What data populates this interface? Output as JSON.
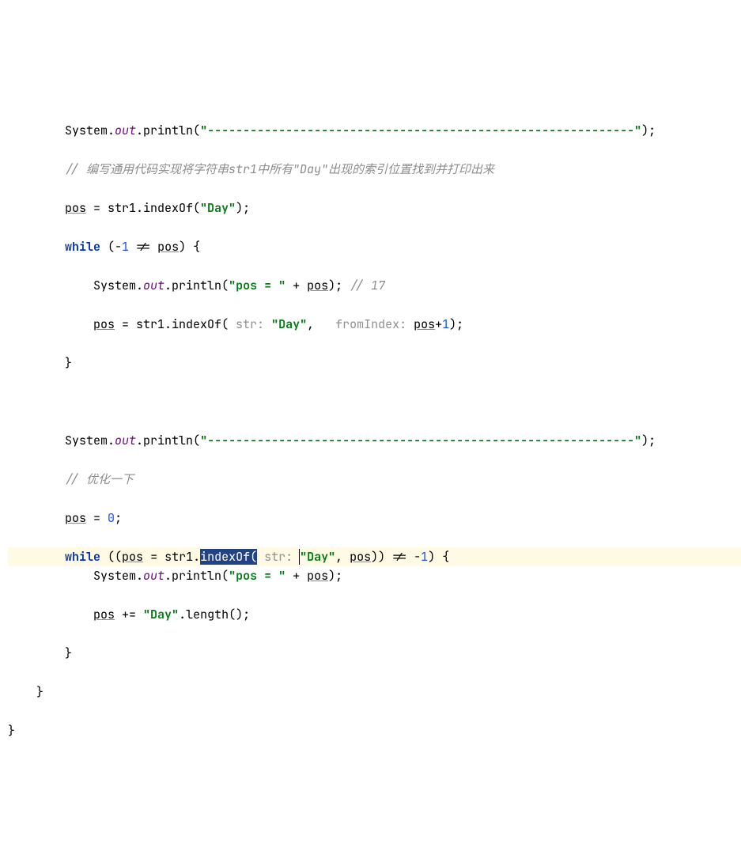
{
  "code": {
    "indent2": "        ",
    "indent3": "            ",
    "indent1": "    ",
    "indent0": "",
    "l1_a": "System.",
    "l1_out": "out",
    "l1_b": ".println(",
    "l1_str": "\"------------------------------------------------------------\"",
    "l1_c": ");",
    "l2_cmt": "// 编写通用代码实现将字符串str1中所有\"Day\"出现的索引位置找到并打印出来",
    "l3_pos": "pos",
    "l3_a": " = str1.indexOf(",
    "l3_str": "\"Day\"",
    "l3_b": ");",
    "l4_while": "while",
    "l4_a": " (-",
    "l4_num1": "1",
    "l4_b": " != ",
    "l4_pos": "pos",
    "l4_c": ") {",
    "l5_a": "System.",
    "l5_out": "out",
    "l5_b": ".println(",
    "l5_str": "\"pos = \"",
    "l5_c": " + ",
    "l5_pos": "pos",
    "l5_d": "); ",
    "l5_cmt": "// 17",
    "l6_pos": "pos",
    "l6_a": " = str1.indexOf(",
    "l6_hint1": " str: ",
    "l6_str": "\"Day\"",
    "l6_b": ",  ",
    "l6_hint2": " fromIndex: ",
    "l6_pos2": "pos",
    "l6_c": "+",
    "l6_num": "1",
    "l6_d": ");",
    "l7_brace": "}",
    "l9_a": "System.",
    "l9_out": "out",
    "l9_b": ".println(",
    "l9_str": "\"------------------------------------------------------------\"",
    "l9_c": ");",
    "l10_cmt": "// 优化一下",
    "l11_pos": "pos",
    "l11_a": " = ",
    "l11_num": "0",
    "l11_b": ";",
    "l12_while": "while",
    "l12_a": " ((",
    "l12_pos": "pos",
    "l12_b": " = str1.",
    "l12_sel": "indexOf(",
    "l12_hint": " str: ",
    "l12_str": "\"Day\"",
    "l12_c": ", ",
    "l12_pos2": "pos",
    "l12_d": ")) != -",
    "l12_num": "1",
    "l12_e": ") {",
    "l13_a": "System.",
    "l13_out": "out",
    "l13_b": ".println(",
    "l13_str": "\"pos = \"",
    "l13_c": " + ",
    "l13_pos": "pos",
    "l13_d": ");",
    "l14_pos": "pos",
    "l14_a": " += ",
    "l14_str": "\"Day\"",
    "l14_b": ".length();",
    "l15_brace": "}",
    "l16_brace": "}",
    "l17_brace": "}"
  }
}
